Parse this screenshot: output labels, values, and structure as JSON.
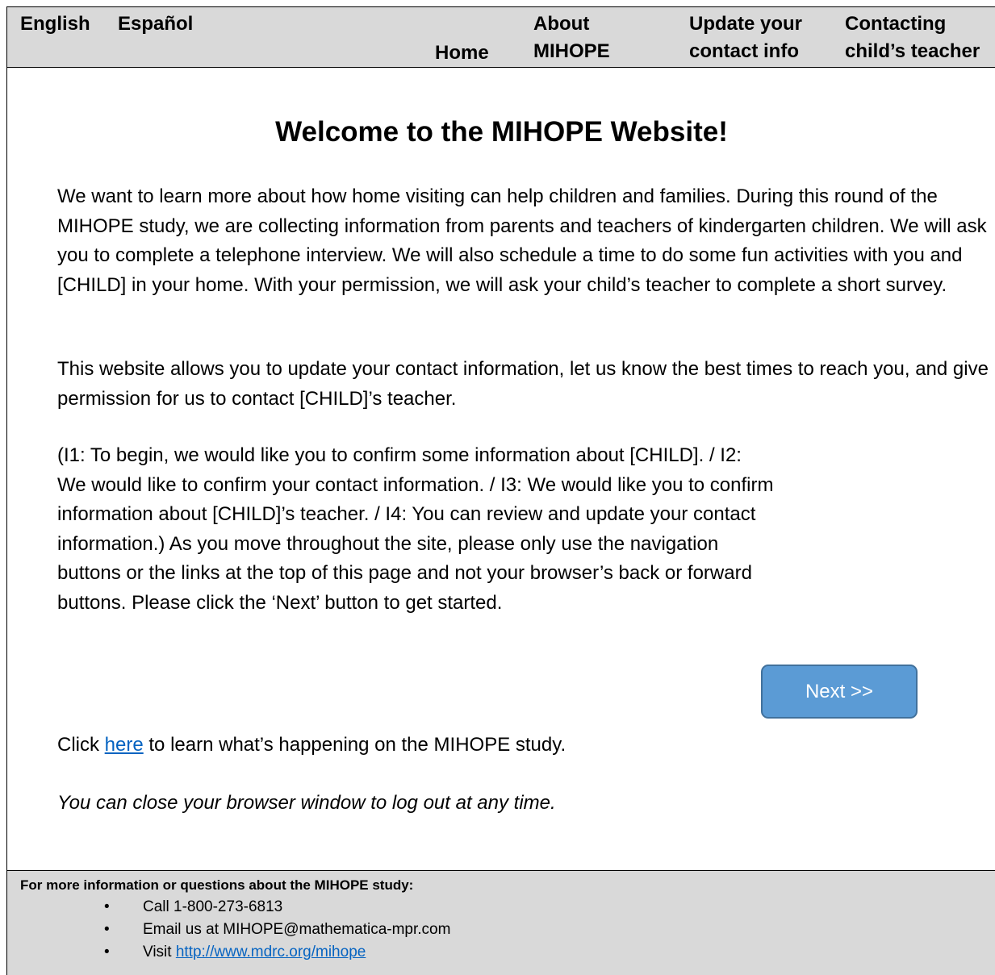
{
  "nav": {
    "english": "English",
    "espanol": "Español",
    "home": "Home",
    "about_line1": "About",
    "about_line2": "MIHOPE",
    "update_line1": "Update your",
    "update_line2": "contact info",
    "contact_line1": "Contacting",
    "contact_line2": "child’s teacher"
  },
  "main": {
    "title": "Welcome to the MIHOPE Website!",
    "paragraph1": "We want to learn more about how home visiting can help children and families. During this round of the MIHOPE study, we are collecting information from parents and teachers of kindergarten children. We will ask you to complete a telephone interview. We will also schedule a time to do some fun activities with you and [CHILD] in your home. With your permission, we will ask your child’s teacher to complete a short survey.",
    "paragraph2": "This website allows you to update your contact information, let us know the best times to reach you, and give permission for us to contact [CHILD]’s teacher.",
    "paragraph3": "(I1: To begin, we would like you to confirm some information about [CHILD]. / I2: We would like to confirm your contact information. / I3: We would like you to confirm information about [CHILD]’s teacher. / I4: You can review and update your contact information.) As you move throughout the site, please only use the navigation buttons or the links at the top of this page and not your browser’s back or forward buttons. Please click the ‘Next’ button to get started.",
    "next_label": "Next >>",
    "click_prefix": "Click ",
    "click_link": "here",
    "click_suffix": " to learn what’s happening on the MIHOPE study.",
    "logout_note": "You can close your browser window to log out at any time."
  },
  "footer": {
    "heading": "For more information or questions about the MIHOPE study:",
    "bullet": "•",
    "call": "Call 1-800-273-6813",
    "email": "Email us at MIHOPE@mathematica-mpr.com",
    "visit_prefix": "Visit ",
    "visit_link": "http://www.mdrc.org/mihope"
  },
  "colors": {
    "nav_background": "#d9d9d9",
    "button_fill": "#5b9bd5",
    "button_border": "#41719c",
    "link": "#0563c1"
  }
}
